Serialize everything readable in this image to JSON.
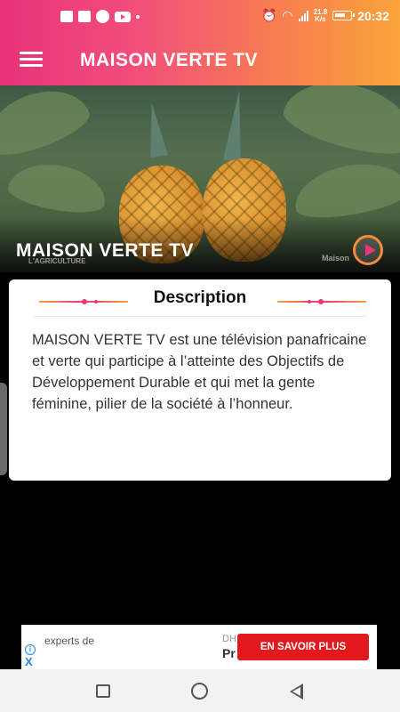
{
  "status_bar": {
    "time": "20:32",
    "net_speed_value": "21.8",
    "net_speed_unit": "K/s",
    "icons": [
      "facebook-icon",
      "message-icon",
      "circle-icon",
      "youtube-icon",
      "dot-icon",
      "alarm-icon",
      "wifi-icon",
      "signal-icon",
      "battery-icon"
    ]
  },
  "app_bar": {
    "title": "MAISON VERTE TV",
    "menu_icon": "hamburger-menu-icon"
  },
  "hero": {
    "title": "MAISON VERTE TV",
    "watermark_left": "L'AGRICULTURE",
    "watermark_right": "Maison",
    "play_icon": "play-icon"
  },
  "description": {
    "heading": "Description",
    "body": "MAISON VERTE TV est une télévision panafricaine et verte qui participe à l’atteinte des Objectifs de Développement Durable et qui met la gente féminine, pilier de la société à l’honneur."
  },
  "ad": {
    "text": "experts de",
    "text_right_top": "DH",
    "text_right": "Pr",
    "cta_label": "EN SAVOIR PLUS",
    "info_icon": "i",
    "close_icon": "X",
    "cta_color": "#e2191c"
  },
  "nav_bar": {
    "icons": [
      "recent-apps-icon",
      "home-icon",
      "back-icon"
    ]
  },
  "colors": {
    "gradient_start": "#e8327a",
    "gradient_end": "#f9a43a",
    "accent": "#e8347a"
  }
}
